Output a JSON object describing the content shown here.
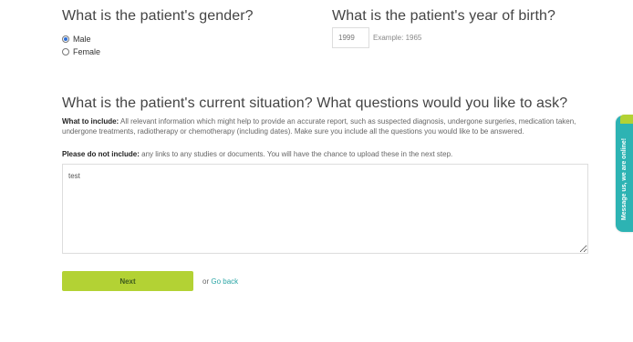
{
  "gender": {
    "title": "What is the patient's gender?",
    "options": [
      {
        "label": "Male",
        "selected": true
      },
      {
        "label": "Female",
        "selected": false
      }
    ]
  },
  "birth_year": {
    "title": "What is the patient's year of birth?",
    "value": "1999",
    "example": "Example: 1965"
  },
  "situation": {
    "title": "What is the patient's current situation? What questions would you like to ask?",
    "include_label": "What to include:",
    "include_text": "All relevant information which might help to provide an accurate report, such as suspected diagnosis, undergone surgeries, medication taken, undergone treatments, radiotherapy or chemotherapy (including dates). Make sure you include all the questions you would like to be answered.",
    "exclude_label": "Please do not include:",
    "exclude_text": "any links to any studies or documents. You will have the chance to upload these in the next step.",
    "value": "test"
  },
  "actions": {
    "next_label": "Next",
    "or_text": "or",
    "go_back_label": "Go back"
  },
  "chat": {
    "label": "Message us, we are online!"
  },
  "colors": {
    "accent_green": "#b3d234",
    "chat_teal": "#2db3b3",
    "link_teal": "#2aa5a5"
  }
}
